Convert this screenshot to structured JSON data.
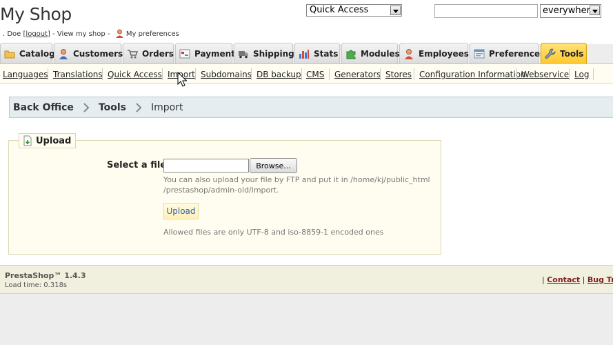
{
  "header": {
    "shop_title": "My Shop",
    "user_prefix": ". Doe [",
    "logout_label": "logout",
    "user_mid": "] - View my shop -",
    "preferences_label": "My preferences",
    "quick_access_value": "Quick Access",
    "search_value": "",
    "search_scope": "everywhere"
  },
  "tabs": [
    {
      "label": "Catalog",
      "icon": "folder-icon"
    },
    {
      "label": "Customers",
      "icon": "customer-icon"
    },
    {
      "label": "Orders",
      "icon": "cart-icon"
    },
    {
      "label": "Payment",
      "icon": "payment-icon"
    },
    {
      "label": "Shipping",
      "icon": "truck-icon"
    },
    {
      "label": "Stats",
      "icon": "stats-icon"
    },
    {
      "label": "Modules",
      "icon": "puzzle-icon"
    },
    {
      "label": "Employees",
      "icon": "employee-icon"
    },
    {
      "label": "Preferences",
      "icon": "preferences-icon"
    },
    {
      "label": "Tools",
      "icon": "wrench-icon",
      "active": true
    }
  ],
  "subnav": [
    "Languages",
    "Translations",
    "Quick Access",
    "Import",
    "Subdomains",
    "DB backup",
    "CMS",
    "Generators",
    "Stores",
    "Configuration Information",
    "Webservice",
    "Log"
  ],
  "breadcrumb": [
    "Back Office",
    "Tools",
    "Import"
  ],
  "upload": {
    "legend": "Upload",
    "file_label": "Select a file",
    "browse_label": "Browse...",
    "hint": "You can also upload your file by FTP and put it in /home/kj/public_html /prestashop/admin-old/import.",
    "upload_button": "Upload",
    "allowed_text": "Allowed files are only UTF-8 and iso-8859-1 encoded ones"
  },
  "footer": {
    "version": "PrestaShop™ 1.4.3",
    "load_time": "Load time: 0.318s",
    "sep": "|",
    "contact": "Contact",
    "bug_tracker": "Bug Tracker"
  },
  "colors": {
    "active_tab": "#ffc82d",
    "breadcrumb_bg": "#e6edf1",
    "fieldset_bg": "#fffdef",
    "footer_bg": "#f1efde"
  }
}
